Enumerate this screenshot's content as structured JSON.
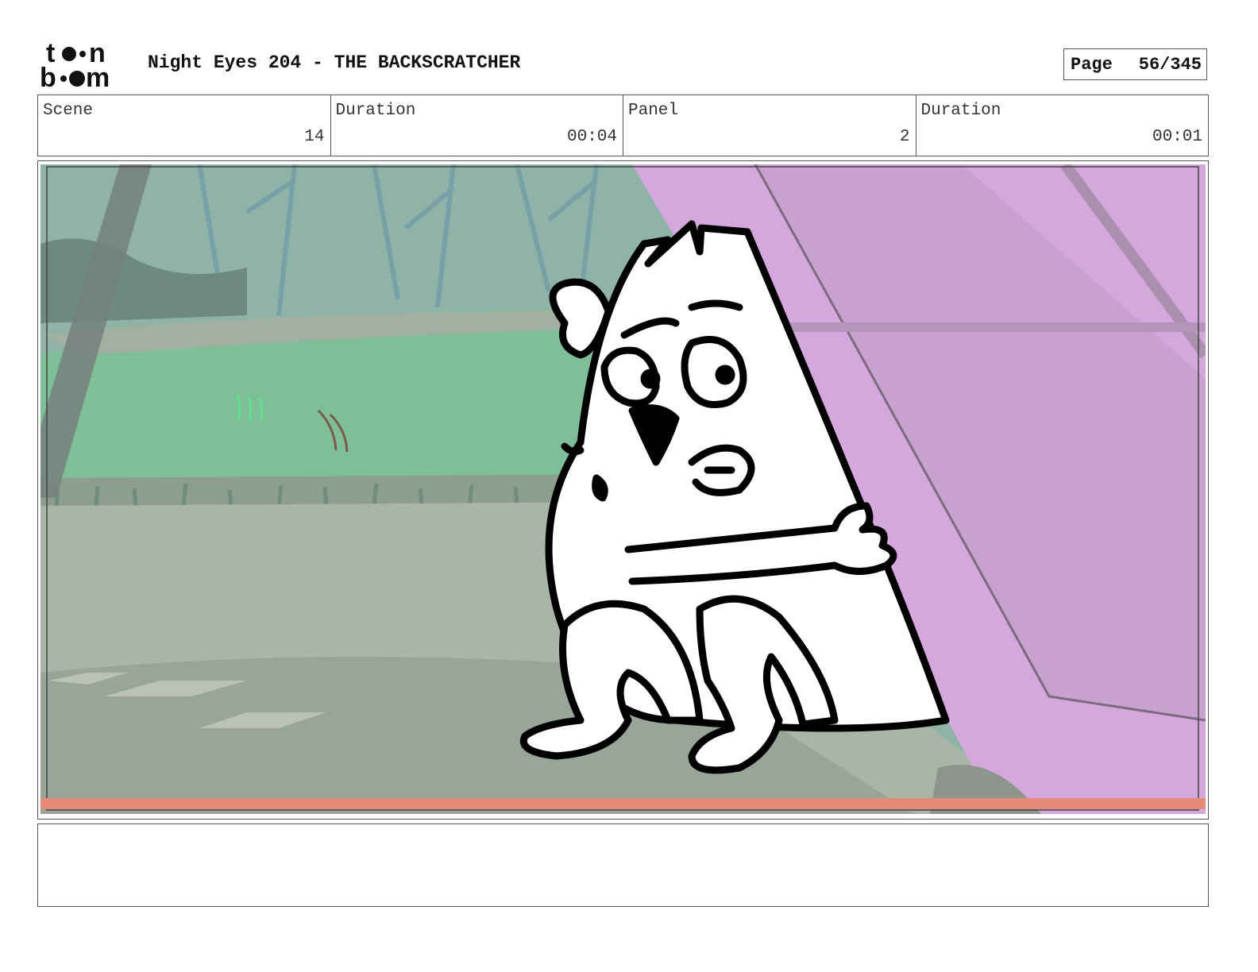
{
  "header": {
    "logo_text": "toonboom",
    "title": "Night Eyes 204 - THE BACKSCRATCHER",
    "page_label": "Page",
    "page_value": "56/345"
  },
  "info": {
    "scene_label": "Scene",
    "scene_value": "14",
    "scene_duration_label": "Duration",
    "scene_duration_value": "00:04",
    "panel_label": "Panel",
    "panel_value": "2",
    "panel_duration_label": "Duration",
    "panel_duration_value": "00:01"
  },
  "notes": {
    "text": ""
  },
  "colors": {
    "sky": "#8fb3a7",
    "grass": "#7fbf98",
    "floor": "#a9b5a6",
    "wall": "#d4a8dc",
    "safe_line": "#e48b7a",
    "ink": "#000000"
  }
}
